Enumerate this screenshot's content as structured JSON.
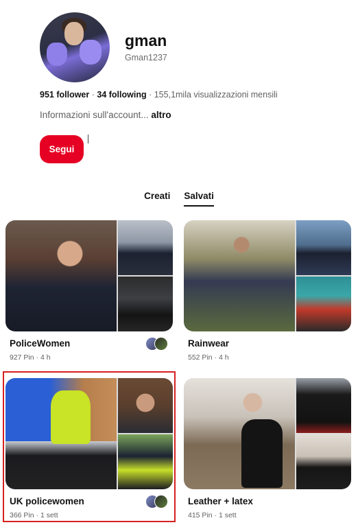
{
  "profile": {
    "name": "gman",
    "handle": "Gman1237",
    "followers": "951 follower",
    "following": "34 following",
    "views": "155,1mila visualizzazioni mensili",
    "about": "Informazioni sull'account...",
    "about_more": "altro",
    "follow_label": "Segui"
  },
  "tabs": [
    {
      "label": "Creati",
      "active": false
    },
    {
      "label": "Salvati",
      "active": true
    }
  ],
  "boards": [
    {
      "title": "PoliceWomen",
      "meta": "927 Pin · 4 h",
      "has_collaborators": true
    },
    {
      "title": "Rainwear",
      "meta": "552 Pin · 4 h",
      "has_collaborators": false
    },
    {
      "title": "UK policewomen",
      "meta": "366 Pin · 1 sett",
      "has_collaborators": true,
      "highlighted": true
    },
    {
      "title": "Leather + latex",
      "meta": "415 Pin · 1 sett",
      "has_collaborators": false
    }
  ],
  "colors": {
    "accent": "#e60023",
    "highlight": "#d61f1f"
  }
}
